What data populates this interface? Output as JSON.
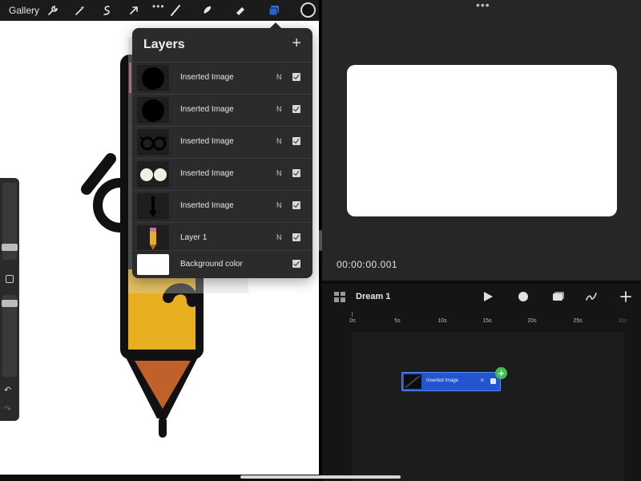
{
  "toolbar": {
    "gallery_label": "Gallery",
    "more_label": "•••",
    "icons": [
      "wrench-icon",
      "magic-wand-icon",
      "selection-icon",
      "transform-arrow-icon",
      "brush-icon",
      "smudge-icon",
      "eraser-icon",
      "layers-icon",
      "color-swatch"
    ]
  },
  "layers": {
    "title": "Layers",
    "add_label": "+",
    "items": [
      {
        "name": "Inserted Image",
        "mode": "N",
        "visible": true,
        "thumb": "black-circle"
      },
      {
        "name": "Inserted Image",
        "mode": "N",
        "visible": true,
        "thumb": "black-circle"
      },
      {
        "name": "Inserted Image",
        "mode": "N",
        "visible": true,
        "thumb": "glasses"
      },
      {
        "name": "Inserted Image",
        "mode": "N",
        "visible": true,
        "thumb": "white-eyes"
      },
      {
        "name": "Inserted Image",
        "mode": "N",
        "visible": true,
        "thumb": "pencil-tip"
      },
      {
        "name": "Layer 1",
        "mode": "N",
        "visible": true,
        "thumb": "pencil"
      },
      {
        "name": "Background color",
        "mode": "",
        "visible": true,
        "thumb": "white"
      }
    ]
  },
  "preview": {
    "dots_label": "•••",
    "timecode": "00:00:00.001"
  },
  "timeline": {
    "project_name": "Dream 1",
    "ruler_labels": [
      "0s",
      "5s",
      "10s",
      "15s",
      "20s",
      "25s",
      "30s"
    ],
    "clip": {
      "name": "Inserted Image",
      "mode": "N"
    },
    "clip_add_label": "+"
  },
  "colors": {
    "clip_blue": "#2256d0",
    "add_green": "#3fbf4f",
    "pencil_yellow": "#e8b020",
    "pencil_tip": "#c0602a"
  }
}
